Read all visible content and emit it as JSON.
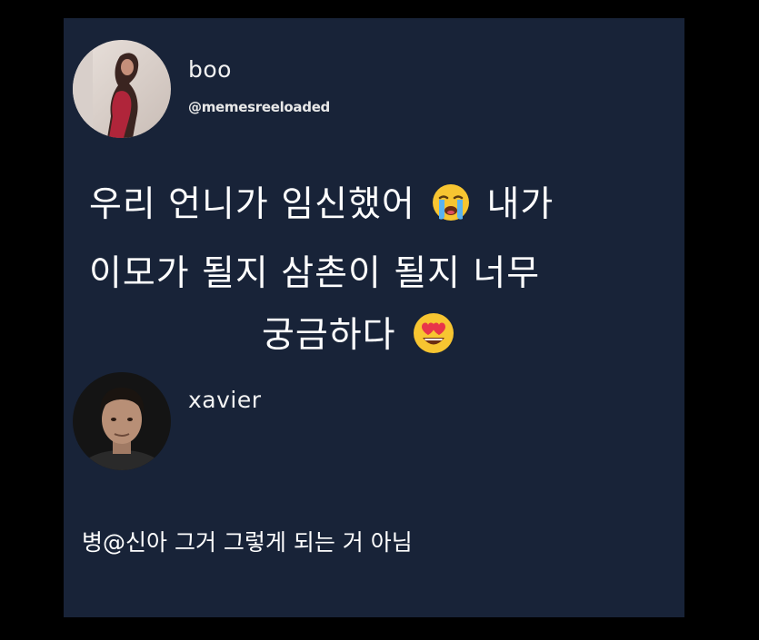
{
  "post": {
    "author": {
      "display_name": "boo",
      "handle": "memesreeloaded",
      "handle_symbol": "@"
    },
    "lines": [
      {
        "before": "우리 언니가 임신했어",
        "emoji": "loudly-crying-face-emoji",
        "after": "내가"
      },
      {
        "before": "이모가 될지 삼촌이 될지 너무",
        "emoji": "",
        "after": ""
      },
      {
        "before": "궁금하다",
        "emoji": "heart-eyes-face-emoji",
        "after": ""
      }
    ]
  },
  "reply": {
    "author": {
      "display_name": "xavier"
    },
    "text_before": "병",
    "text_symbol": "@",
    "text_after": "신아 그거 그렇게 되는 거 아님"
  },
  "colors": {
    "page_background": "#000000",
    "card_background": "#182338",
    "text": "#ffffff"
  }
}
